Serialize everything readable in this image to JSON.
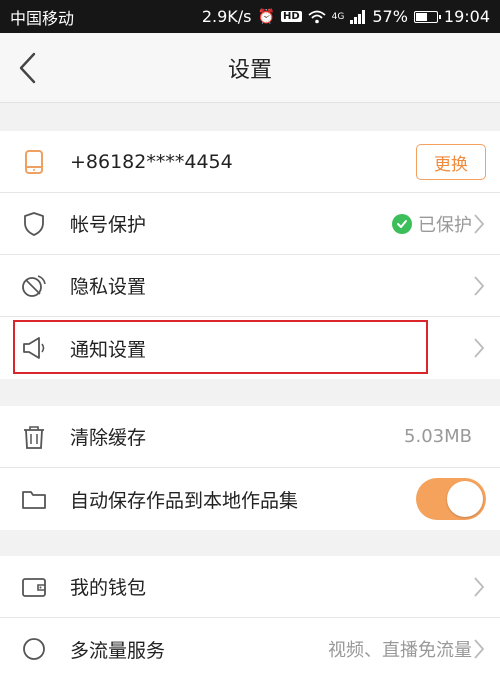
{
  "status_bar": {
    "carrier": "中国移动",
    "net_speed": "2.9K/s",
    "hd_badge": "HD",
    "network_type": "4G",
    "battery": "57%",
    "battery_level": 0.57,
    "time": "19:04"
  },
  "nav": {
    "title": "设置"
  },
  "account": {
    "phone": "+86182****4454",
    "change_label": "更换",
    "account_protection_label": "帐号保护",
    "protected_status": "已保护",
    "privacy_label": "隐私设置",
    "notification_label": "通知设置"
  },
  "storage": {
    "clear_cache_label": "清除缓存",
    "cache_size": "5.03MB",
    "auto_save_label": "自动保存作品到本地作品集",
    "auto_save_on": true
  },
  "services": {
    "wallet_label": "我的钱包",
    "data_service_label": "多流量服务",
    "data_service_value": "视频、直播免流量"
  },
  "colors": {
    "accent": "#f08a3c",
    "toggle_on": "#f5a25d",
    "check_green": "#3cbf5a",
    "highlight_red": "#d9262b"
  },
  "icons": {
    "phone": "phone-icon",
    "shield": "shield-icon",
    "privacy": "privacy-icon",
    "notification": "megaphone-icon",
    "trash": "trash-icon",
    "folder": "folder-icon",
    "wallet": "wallet-icon"
  }
}
